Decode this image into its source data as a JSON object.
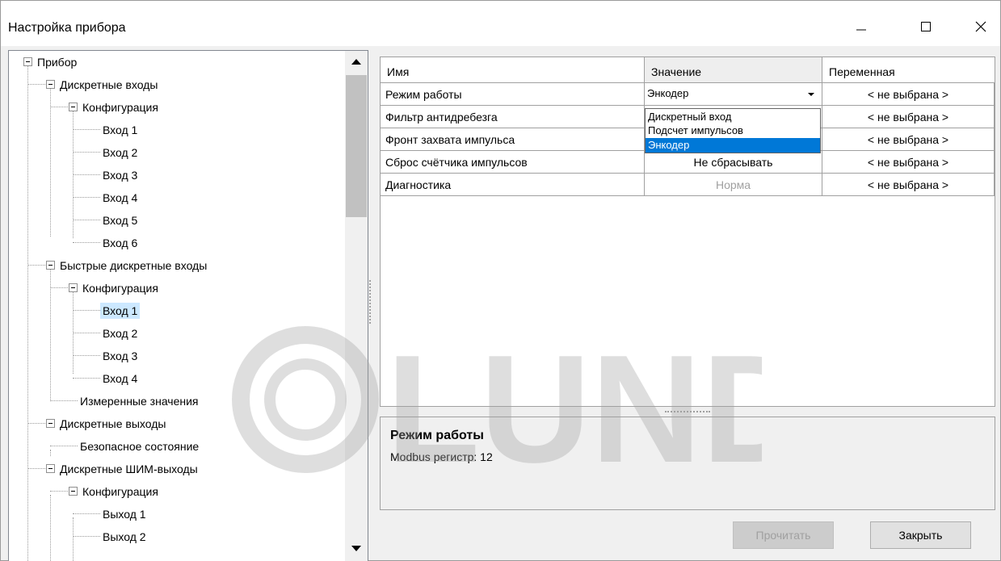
{
  "window": {
    "title": "Настройка прибора",
    "controls": [
      "minimize-icon",
      "maximize-icon",
      "close-icon"
    ]
  },
  "tree": {
    "items": [
      {
        "label": "Прибор"
      },
      {
        "label": "Дискретные входы"
      },
      {
        "label": "Конфигурация"
      },
      {
        "label": "Вход 1"
      },
      {
        "label": "Вход 2"
      },
      {
        "label": "Вход 3"
      },
      {
        "label": "Вход 4"
      },
      {
        "label": "Вход 5"
      },
      {
        "label": "Вход 6"
      },
      {
        "label": "Быстрые дискретные входы"
      },
      {
        "label": "Конфигурация"
      },
      {
        "label": "Вход 1"
      },
      {
        "label": "Вход 2"
      },
      {
        "label": "Вход 3"
      },
      {
        "label": "Вход 4"
      },
      {
        "label": "Измеренные значения"
      },
      {
        "label": "Дискретные выходы"
      },
      {
        "label": "Безопасное состояние"
      },
      {
        "label": "Дискретные ШИМ-выходы"
      },
      {
        "label": "Конфигурация"
      },
      {
        "label": "Выход 1"
      },
      {
        "label": "Выход 2"
      }
    ],
    "selected_index": 11
  },
  "grid": {
    "headers": {
      "name": "Имя",
      "value": "Значение",
      "variable": "Переменная"
    },
    "rows": [
      {
        "name": "Режим работы",
        "value": "Энкодер",
        "variable": "< не выбрана >"
      },
      {
        "name": "Фильтр антидребезга",
        "value": "",
        "variable": "< не выбрана >"
      },
      {
        "name": "Фронт захвата импульса",
        "value": "",
        "variable": "< не выбрана >"
      },
      {
        "name": "Сброс счётчика импульсов",
        "value": "Не сбрасывать",
        "variable": "< не выбрана >"
      },
      {
        "name": "Диагностика",
        "value": "Норма",
        "variable": "< не выбрана >"
      }
    ],
    "dropdown_options": [
      "Дискретный вход",
      "Подсчет импульсов",
      "Энкодер"
    ],
    "dropdown_selected": "Энкодер"
  },
  "description": {
    "title": "Режим работы",
    "text": "Modbus регистр: 12"
  },
  "buttons": {
    "read": "Прочитать",
    "close": "Закрыть"
  },
  "watermark": "LUNDA",
  "colors": {
    "selection_blue": "#0078d7",
    "tree_selection": "#cce8ff",
    "muted_text": "#a0a0a0"
  }
}
